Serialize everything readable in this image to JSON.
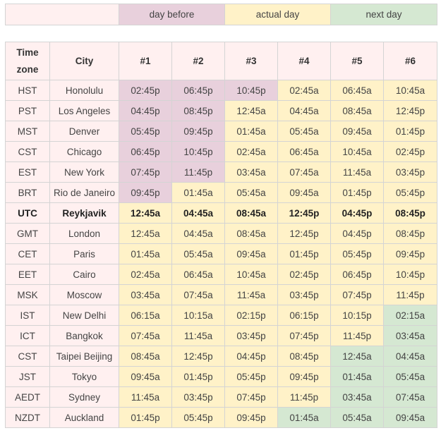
{
  "legend": {
    "day_before": "day before",
    "actual_day": "actual day",
    "next_day": "next day"
  },
  "colors": {
    "day_before": "#e8d0dc",
    "actual_day": "#fff2c8",
    "next_day": "#d5e8d2",
    "label_cells": "#fff0f0",
    "border": "#d4d4d4"
  },
  "headers": [
    "Time zone",
    "City",
    "#1",
    "#2",
    "#3",
    "#4",
    "#5",
    "#6"
  ],
  "rows": [
    {
      "zone": "HST",
      "city": "Honolulu",
      "times": [
        "02:45p",
        "06:45p",
        "10:45p",
        "02:45a",
        "06:45a",
        "10:45a"
      ],
      "days": [
        "before",
        "before",
        "before",
        "actual",
        "actual",
        "actual"
      ]
    },
    {
      "zone": "PST",
      "city": "Los Angeles",
      "times": [
        "04:45p",
        "08:45p",
        "12:45a",
        "04:45a",
        "08:45a",
        "12:45p"
      ],
      "days": [
        "before",
        "before",
        "actual",
        "actual",
        "actual",
        "actual"
      ]
    },
    {
      "zone": "MST",
      "city": "Denver",
      "times": [
        "05:45p",
        "09:45p",
        "01:45a",
        "05:45a",
        "09:45a",
        "01:45p"
      ],
      "days": [
        "before",
        "before",
        "actual",
        "actual",
        "actual",
        "actual"
      ]
    },
    {
      "zone": "CST",
      "city": "Chicago",
      "times": [
        "06:45p",
        "10:45p",
        "02:45a",
        "06:45a",
        "10:45a",
        "02:45p"
      ],
      "days": [
        "before",
        "before",
        "actual",
        "actual",
        "actual",
        "actual"
      ]
    },
    {
      "zone": "EST",
      "city": "New York",
      "times": [
        "07:45p",
        "11:45p",
        "03:45a",
        "07:45a",
        "11:45a",
        "03:45p"
      ],
      "days": [
        "before",
        "before",
        "actual",
        "actual",
        "actual",
        "actual"
      ]
    },
    {
      "zone": "BRT",
      "city": "Rio de Janeiro",
      "times": [
        "09:45p",
        "01:45a",
        "05:45a",
        "09:45a",
        "01:45p",
        "05:45p"
      ],
      "days": [
        "before",
        "actual",
        "actual",
        "actual",
        "actual",
        "actual"
      ]
    },
    {
      "zone": "UTC",
      "city": "Reykjavik",
      "times": [
        "12:45a",
        "04:45a",
        "08:45a",
        "12:45p",
        "04:45p",
        "08:45p"
      ],
      "days": [
        "actual",
        "actual",
        "actual",
        "actual",
        "actual",
        "actual"
      ],
      "bold": true
    },
    {
      "zone": "GMT",
      "city": "London",
      "times": [
        "12:45a",
        "04:45a",
        "08:45a",
        "12:45p",
        "04:45p",
        "08:45p"
      ],
      "days": [
        "actual",
        "actual",
        "actual",
        "actual",
        "actual",
        "actual"
      ]
    },
    {
      "zone": "CET",
      "city": "Paris",
      "times": [
        "01:45a",
        "05:45a",
        "09:45a",
        "01:45p",
        "05:45p",
        "09:45p"
      ],
      "days": [
        "actual",
        "actual",
        "actual",
        "actual",
        "actual",
        "actual"
      ]
    },
    {
      "zone": "EET",
      "city": "Cairo",
      "times": [
        "02:45a",
        "06:45a",
        "10:45a",
        "02:45p",
        "06:45p",
        "10:45p"
      ],
      "days": [
        "actual",
        "actual",
        "actual",
        "actual",
        "actual",
        "actual"
      ]
    },
    {
      "zone": "MSK",
      "city": "Moscow",
      "times": [
        "03:45a",
        "07:45a",
        "11:45a",
        "03:45p",
        "07:45p",
        "11:45p"
      ],
      "days": [
        "actual",
        "actual",
        "actual",
        "actual",
        "actual",
        "actual"
      ]
    },
    {
      "zone": "IST",
      "city": "New Delhi",
      "times": [
        "06:15a",
        "10:15a",
        "02:15p",
        "06:15p",
        "10:15p",
        "02:15a"
      ],
      "days": [
        "actual",
        "actual",
        "actual",
        "actual",
        "actual",
        "next"
      ]
    },
    {
      "zone": "ICT",
      "city": "Bangkok",
      "times": [
        "07:45a",
        "11:45a",
        "03:45p",
        "07:45p",
        "11:45p",
        "03:45a"
      ],
      "days": [
        "actual",
        "actual",
        "actual",
        "actual",
        "actual",
        "next"
      ]
    },
    {
      "zone": "CST",
      "city": "Taipei Beijing",
      "times": [
        "08:45a",
        "12:45p",
        "04:45p",
        "08:45p",
        "12:45a",
        "04:45a"
      ],
      "days": [
        "actual",
        "actual",
        "actual",
        "actual",
        "next",
        "next"
      ]
    },
    {
      "zone": "JST",
      "city": "Tokyo",
      "times": [
        "09:45a",
        "01:45p",
        "05:45p",
        "09:45p",
        "01:45a",
        "05:45a"
      ],
      "days": [
        "actual",
        "actual",
        "actual",
        "actual",
        "next",
        "next"
      ]
    },
    {
      "zone": "AEDT",
      "city": "Sydney",
      "times": [
        "11:45a",
        "03:45p",
        "07:45p",
        "11:45p",
        "03:45a",
        "07:45a"
      ],
      "days": [
        "actual",
        "actual",
        "actual",
        "actual",
        "next",
        "next"
      ]
    },
    {
      "zone": "NZDT",
      "city": "Auckland",
      "times": [
        "01:45p",
        "05:45p",
        "09:45p",
        "01:45a",
        "05:45a",
        "09:45a"
      ],
      "days": [
        "actual",
        "actual",
        "actual",
        "next",
        "next",
        "next"
      ]
    }
  ]
}
